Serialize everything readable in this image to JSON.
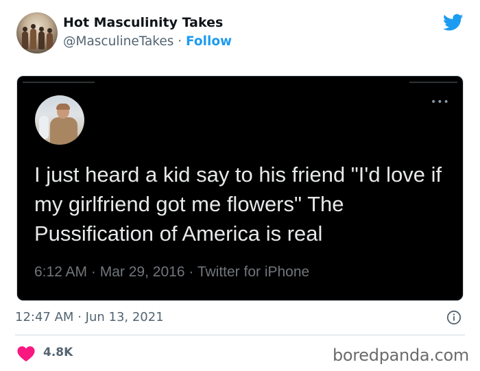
{
  "author": {
    "name": "Hot Masculinity Takes",
    "handle": "@MasculineTakes",
    "separator": "·",
    "follow_label": "Follow"
  },
  "icons": {
    "bird": "twitter-bird-icon",
    "more": "more-dots-icon",
    "info": "info-icon",
    "heart": "heart-icon"
  },
  "colors": {
    "accent": "#1d9bf0",
    "heart": "#f91880",
    "card_bg": "#000000"
  },
  "embedded_tweet": {
    "more_label": "•••",
    "text": "I just heard a kid say to his friend \"I'd love if my girlfriend got me flowers\" The Pussification of America is real",
    "time": "6:12 AM",
    "date": "Mar 29, 2016",
    "source": "Twitter for iPhone",
    "separator": "·"
  },
  "timestamp": {
    "time": "12:47 AM",
    "date": "Jun 13, 2021",
    "separator": "·"
  },
  "stats": {
    "likes": "4.8K"
  },
  "watermark": "boredpanda.com"
}
